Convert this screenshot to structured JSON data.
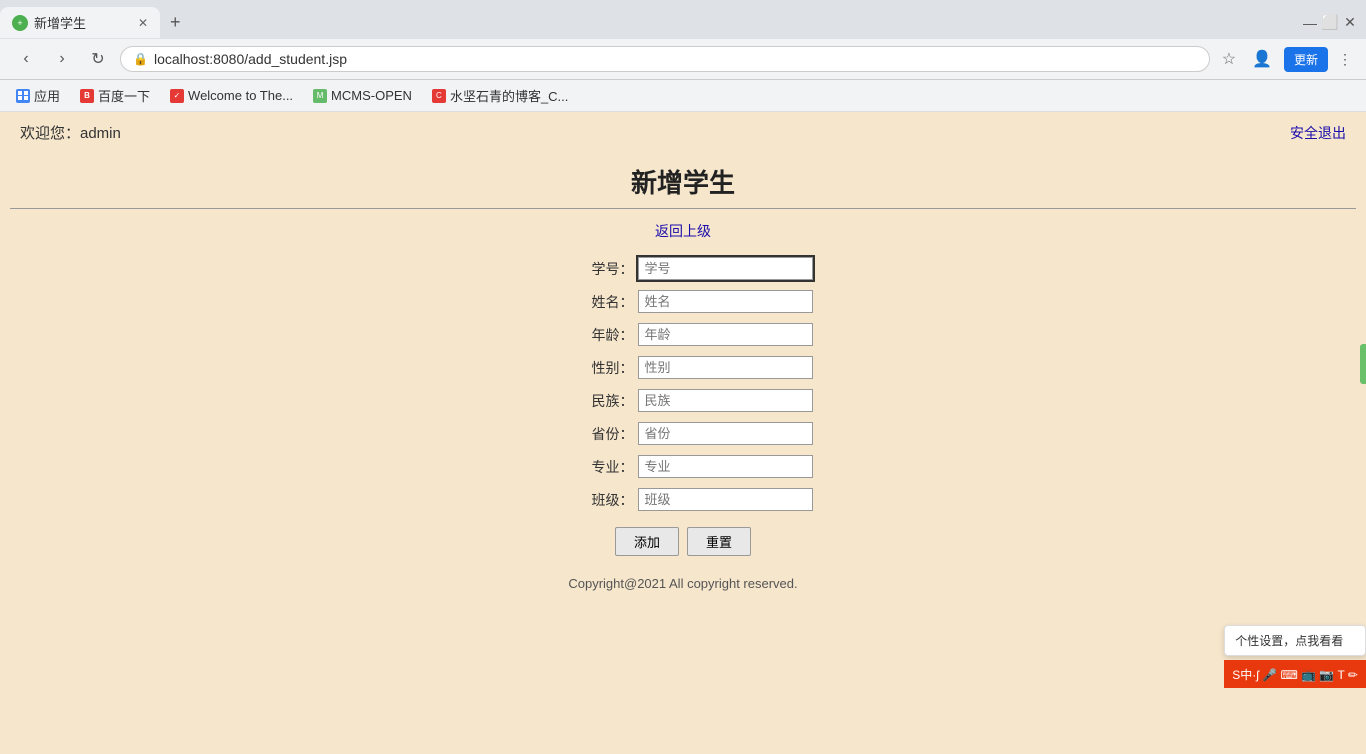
{
  "browser": {
    "tab": {
      "title": "新增学生",
      "favicon_color": "#4caf50",
      "favicon_char": "+"
    },
    "address": "localhost:8080/add_student.jsp",
    "update_btn": "更新",
    "more_icon": "⋮"
  },
  "bookmarks": [
    {
      "label": "应用",
      "icon_color": "#4285f4"
    },
    {
      "label": "百度一下",
      "icon_color": "#e53935"
    },
    {
      "label": "Welcome to The...",
      "icon_color": "#e53935"
    },
    {
      "label": "MCMS-OPEN",
      "icon_color": "#66bb6a"
    },
    {
      "label": "水坚石青的博客_C...",
      "icon_color": "#e53935"
    }
  ],
  "page": {
    "welcome": "欢迎您：admin",
    "logout": "安全退出",
    "title": "新增学生",
    "back_link": "返回上级",
    "fields": [
      {
        "label": "学号：",
        "placeholder": "学号"
      },
      {
        "label": "姓名：",
        "placeholder": "姓名"
      },
      {
        "label": "年龄：",
        "placeholder": "年龄"
      },
      {
        "label": "性别：",
        "placeholder": "性别"
      },
      {
        "label": "民族：",
        "placeholder": "民族"
      },
      {
        "label": "省份：",
        "placeholder": "省份"
      },
      {
        "label": "专业：",
        "placeholder": "专业"
      },
      {
        "label": "班级：",
        "placeholder": "班级"
      }
    ],
    "btn_add": "添加",
    "btn_reset": "重置",
    "footer": "Copyright@2021 All copyright reserved.",
    "feedback_tooltip": "个性设置，点我看看"
  }
}
